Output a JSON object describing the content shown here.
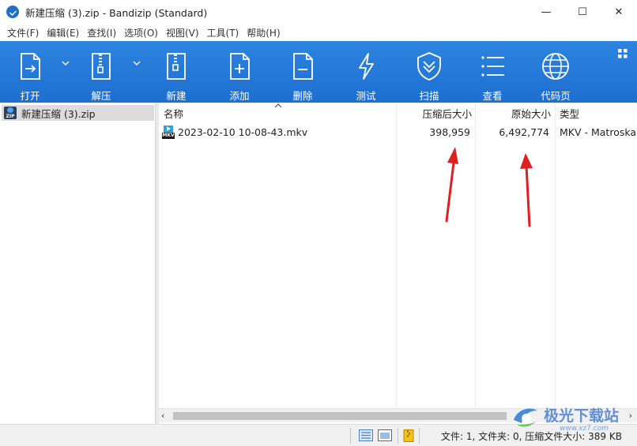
{
  "window": {
    "title": "新建压缩 (3).zip - Bandizip (Standard)",
    "controls": {
      "minimize": "—",
      "maximize": "☐",
      "close": "✕"
    }
  },
  "menu": [
    "文件(F)",
    "编辑(E)",
    "查找(I)",
    "选项(O)",
    "视图(V)",
    "工具(T)",
    "帮助(H)"
  ],
  "toolbar": {
    "items": [
      {
        "label": "打开",
        "icon": "open-icon"
      },
      {
        "label": "解压",
        "icon": "extract-icon"
      },
      {
        "label": "新建",
        "icon": "new-archive-icon"
      },
      {
        "label": "添加",
        "icon": "add-icon"
      },
      {
        "label": "删除",
        "icon": "delete-icon"
      },
      {
        "label": "测试",
        "icon": "test-icon"
      },
      {
        "label": "扫描",
        "icon": "scan-icon"
      },
      {
        "label": "查看",
        "icon": "view-icon"
      },
      {
        "label": "代码页",
        "icon": "codepage-icon"
      }
    ],
    "accent": "#1e74d6"
  },
  "tree": {
    "label": "新建压缩 (3).zip",
    "icon_text": "ZIP"
  },
  "columns": {
    "name": "名称",
    "compressed": "压缩后大小",
    "original": "原始大小",
    "type": "类型"
  },
  "files": [
    {
      "name": "2023-02-10 10-08-43.mkv",
      "compressed": "398,959",
      "original": "6,492,774",
      "type": "MKV - Matroska",
      "icon_text": "MKV"
    }
  ],
  "scrollbar": {
    "left_arrow": "‹",
    "right_arrow": "›"
  },
  "status": {
    "text": "文件: 1, 文件夹: 0, 压缩文件大小: 389 KB"
  },
  "watermark": {
    "text": "极光下载站",
    "sub": "www.xz7.com"
  }
}
